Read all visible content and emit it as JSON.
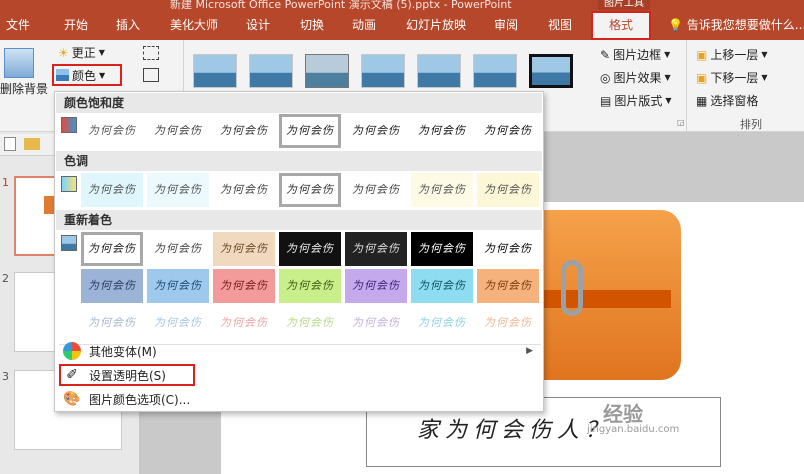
{
  "titlebar": {
    "doc": "新建 Microsoft Office PowerPoint 演示文稿 (5).pptx - PowerPoint",
    "tool_tab": "图片工具"
  },
  "tabs": [
    "文件",
    "开始",
    "插入",
    "美化大师",
    "设计",
    "切换",
    "动画",
    "幻灯片放映",
    "审阅",
    "视图"
  ],
  "active_tab": "格式",
  "tell_me": "告诉我您想要做什么...",
  "ribbon": {
    "remove_bg": "删除背景",
    "corrections": "更正",
    "color": "颜色",
    "border": "图片边框",
    "effects": "图片效果",
    "layout": "图片版式",
    "bring_forward": "上移一层",
    "send_backward": "下移一层",
    "selection_pane": "选择窗格",
    "arrange_group": "排列"
  },
  "dropdown": {
    "saturation_header": "颜色饱和度",
    "tone_header": "色调",
    "recolor_header": "重新着色",
    "sample_text": "为何会伤",
    "more_variations": "其他变体(M)",
    "set_transparent": "设置透明色(S)",
    "color_options": "图片颜色选项(C)..."
  },
  "slides": [
    "1",
    "2",
    "3"
  ],
  "slide_caption": "家为何会伤人？",
  "watermark": "经验",
  "watermark_sub": "jingyan.baidu.com",
  "colors": {
    "accent": "#b7472a",
    "highlight": "#d9221c"
  }
}
